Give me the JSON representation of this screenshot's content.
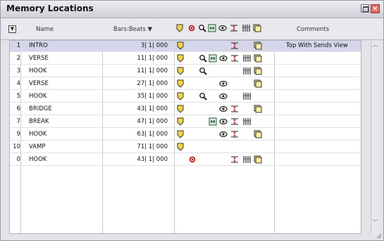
{
  "window": {
    "title": "Memory Locations"
  },
  "header": {
    "name": "Name",
    "bars_beats": "Bars:Beats ▼",
    "comments": "Comments"
  },
  "rows": [
    {
      "num": "1",
      "name": "INTRO",
      "bars": "3| 1| 000",
      "comment": "Top With Sends View",
      "selected": true,
      "icons": [
        "marker",
        "tracks"
      ],
      "icons_offset": [
        [
          13,
          0
        ],
        [
          100,
          0
        ],
        [
          140,
          0
        ]
      ]
    },
    {
      "num": "2",
      "name": "VERSE",
      "bars": "11| 1| 000",
      "comment": ""
    },
    {
      "num": "3",
      "name": "HOOK",
      "bars": "11| 1| 000",
      "comment": ""
    },
    {
      "num": "4",
      "name": "VERSE",
      "bars": "27| 1| 000",
      "comment": ""
    },
    {
      "num": "5",
      "name": "HOOK",
      "bars": "35| 1| 000",
      "comment": ""
    },
    {
      "num": "6",
      "name": "BRIDGE",
      "bars": "43| 1| 000",
      "comment": ""
    },
    {
      "num": "7",
      "name": "BREAK",
      "bars": "47| 1| 000",
      "comment": ""
    },
    {
      "num": "9",
      "name": "HOOK",
      "bars": "63| 1| 000",
      "comment": ""
    },
    {
      "num": "10",
      "name": "VAMP",
      "bars": "71| 1| 000",
      "comment": ""
    },
    {
      "num": "0",
      "name": "HOOK",
      "bars": "43| 1| 000",
      "comment": ""
    }
  ],
  "icon_names": [
    "marker-icon",
    "selection-icon",
    "zoom-icon",
    "preroll-icon",
    "track-show-icon",
    "track-height-icon",
    "group-enable-icon",
    "window-config-icon"
  ],
  "row_icons": [
    [
      "marker-icon",
      "track-height-icon",
      "window-config-icon"
    ],
    [
      "marker-icon",
      "zoom-icon",
      "preroll-icon",
      "track-show-icon",
      "track-height-icon",
      "group-enable-icon",
      "window-config-icon"
    ],
    [
      "marker-icon",
      "zoom-icon",
      "group-enable-icon",
      "window-config-icon"
    ],
    [
      "marker-icon",
      "track-show-icon",
      "window-config-icon"
    ],
    [
      "marker-icon",
      "zoom-icon",
      "track-show-icon",
      "group-enable-icon"
    ],
    [
      "marker-icon",
      "track-show-icon",
      "track-height-icon",
      "window-config-icon"
    ],
    [
      "marker-icon",
      "preroll-icon",
      "track-show-icon",
      "track-height-icon",
      "group-enable-icon"
    ],
    [
      "marker-icon",
      "track-show-icon",
      "track-height-icon",
      "window-config-icon"
    ],
    [
      "marker-icon"
    ],
    [
      "selection-icon",
      "track-height-icon",
      "group-enable-icon",
      "window-config-icon"
    ]
  ]
}
